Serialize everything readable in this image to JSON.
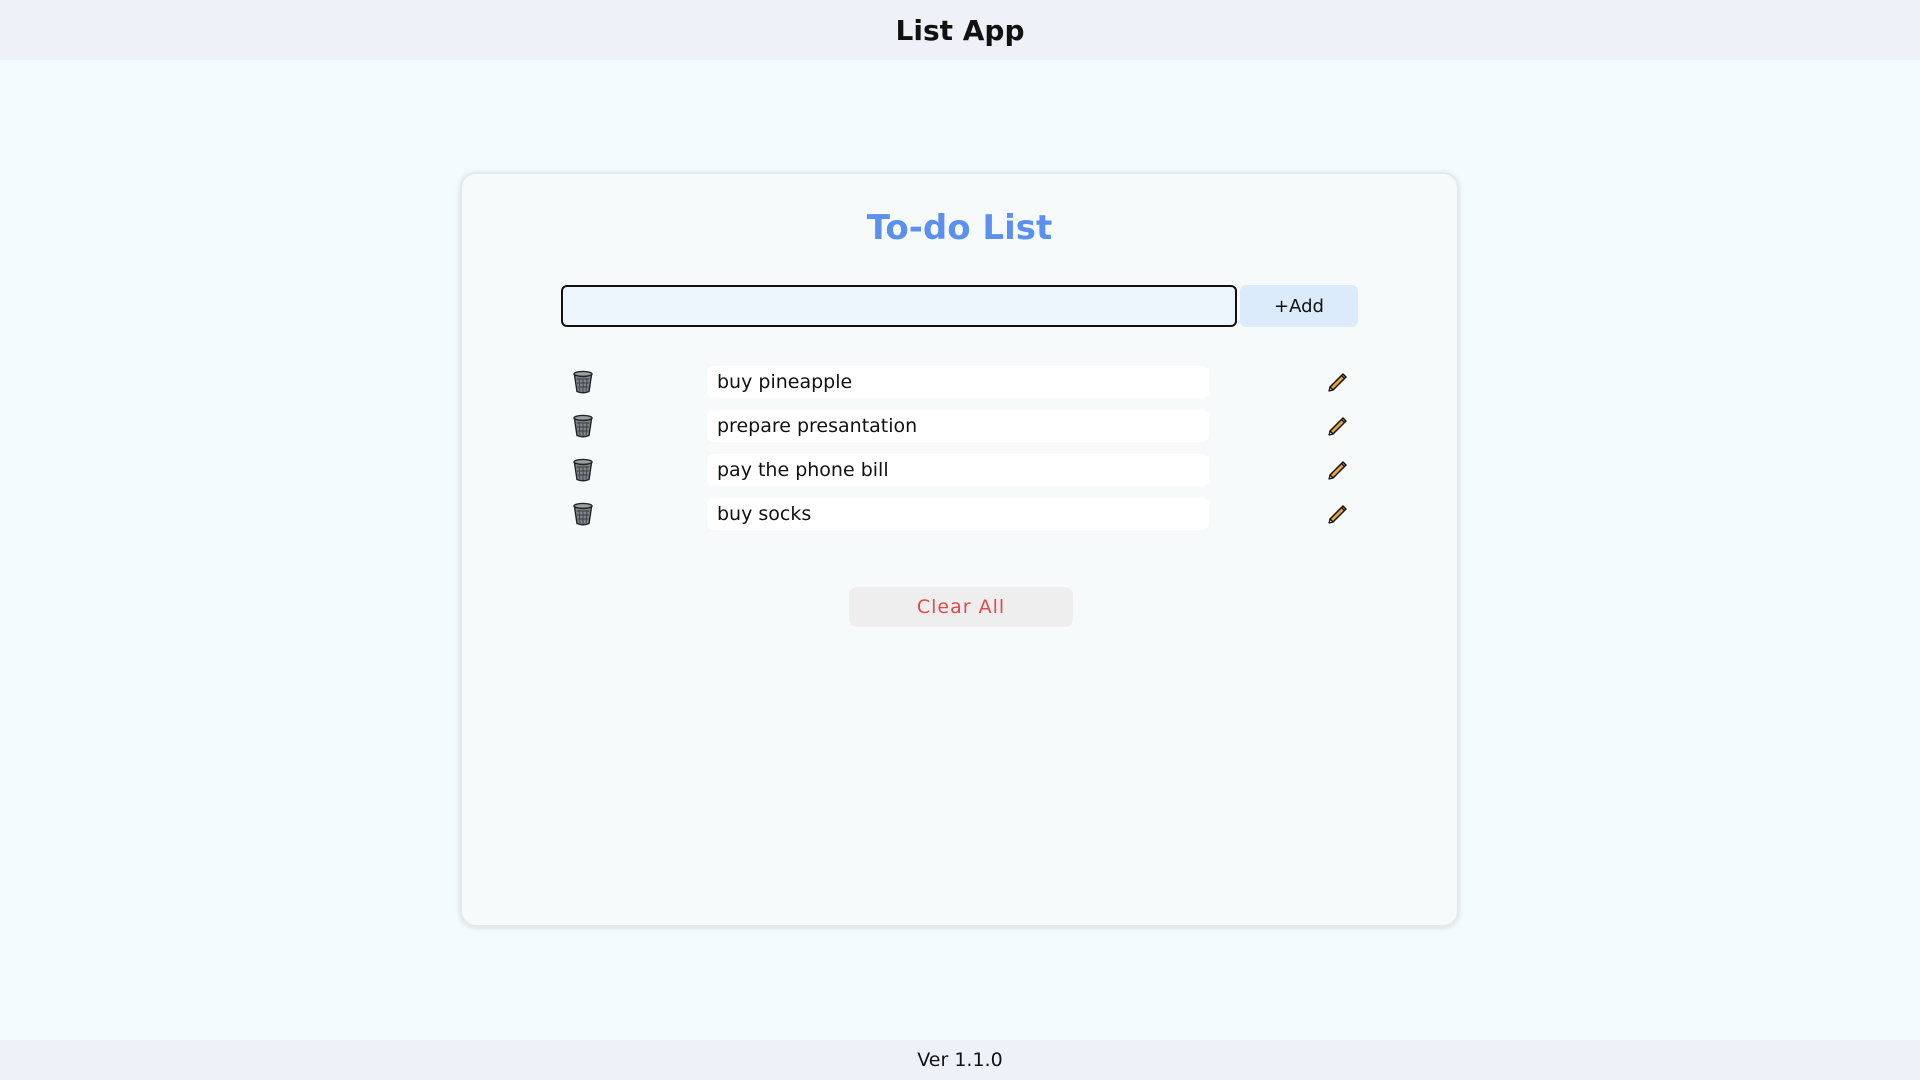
{
  "app": {
    "title": "List App"
  },
  "card": {
    "title": "To-do List",
    "input": {
      "value": "",
      "placeholder": ""
    },
    "add_label": "+Add",
    "items": [
      {
        "text": "buy pineapple",
        "delete_icon": "trash-icon",
        "edit_icon": "pencil-icon"
      },
      {
        "text": "prepare presantation",
        "delete_icon": "trash-icon",
        "edit_icon": "pencil-icon"
      },
      {
        "text": "pay the phone bill",
        "delete_icon": "trash-icon",
        "edit_icon": "pencil-icon"
      },
      {
        "text": "buy socks",
        "delete_icon": "trash-icon",
        "edit_icon": "pencil-icon"
      }
    ],
    "clear_label": "Clear All"
  },
  "footer": {
    "version": "Ver 1.1.0"
  },
  "colors": {
    "accent": "#5b8ff0",
    "danger": "#e24a4a",
    "add_button": "#dcebfb"
  }
}
